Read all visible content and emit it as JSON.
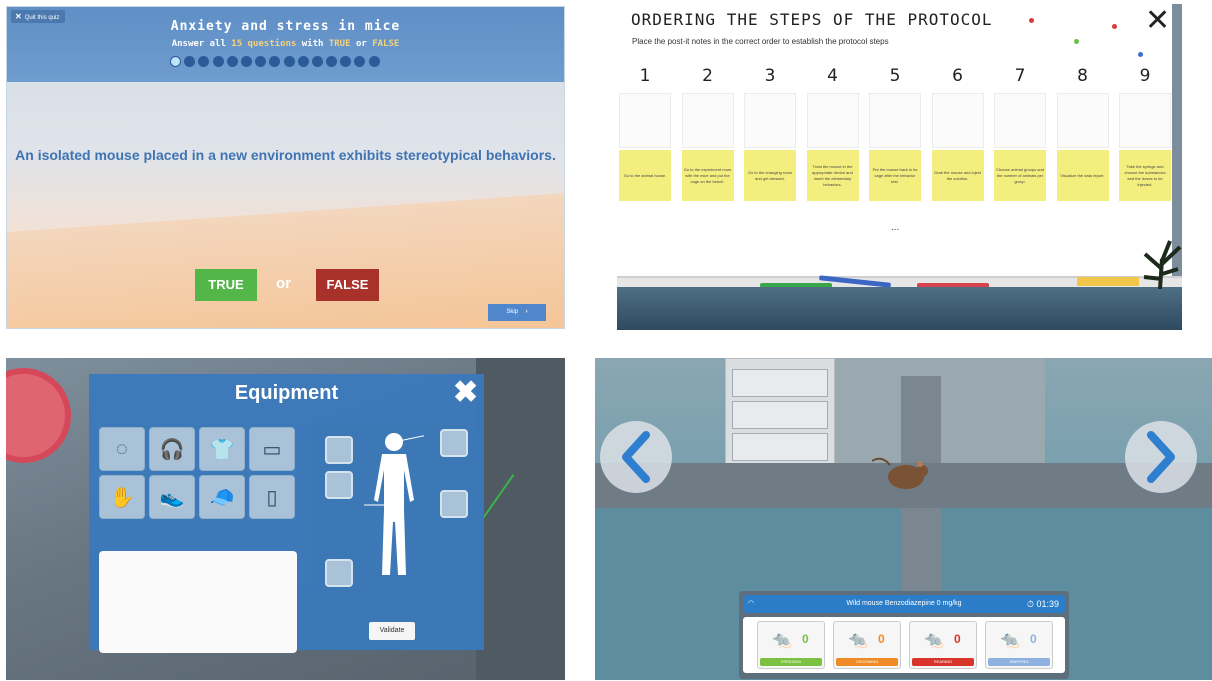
{
  "quiz": {
    "quit_label": "Quit this quiz",
    "title": "Anxiety and stress in mice",
    "subtitle_prefix": "Answer all ",
    "subtitle_count": "15 questions",
    "subtitle_mid": " with ",
    "subtitle_true": "TRUE",
    "subtitle_or": " or ",
    "subtitle_false": "FALSE",
    "question": "An isolated mouse placed in a new environment exhibits stereotypical behaviors.",
    "true_label": "TRUE",
    "or_label": "or",
    "false_label": "FALSE",
    "skip_label": "Skip",
    "total_questions": 15,
    "current_question": 1,
    "colors": {
      "header": "#6a98cd",
      "true": "#52b649",
      "false": "#a8322a",
      "accent": "#f6d17a"
    }
  },
  "protocol": {
    "title": "ORDERING THE STEPS OF THE PROTOCOL",
    "subtitle": "Place the post-it notes in the correct order to establish the protocol steps",
    "close_icon": "close-icon",
    "steps": [
      "1",
      "2",
      "3",
      "4",
      "5",
      "6",
      "7",
      "8",
      "9"
    ],
    "notes": [
      "Go to the animal house.",
      "Go to the experiment room with the mice and put the cage on the bench.",
      "Go to the changing room and get dressed.",
      "Treat the mouse in the appropriate device and insert the elementary behaviors.",
      "Put the mouse back in its cage after the behavior test.",
      "Grab the mouse and inject the solution.",
      "Choose animal groups and the number of animals per group.",
      "Visualize the data report.",
      "Take the syringe and choose the substances and the doses to be injected."
    ],
    "ellipsis": "...",
    "colors": {
      "note": "#f3ee7e"
    }
  },
  "equipment": {
    "title": "Equipment",
    "validate_label": "Validate",
    "items": [
      "hairnet-icon",
      "headphones-icon",
      "lab-coat-icon",
      "mask-icon",
      "gloves-icon",
      "shoe-covers-icon",
      "cap-icon",
      "phone-icon"
    ]
  },
  "maze": {
    "hud_title": "Wild mouse Benzodiazepine 0 mg/kg",
    "timer": "01:39",
    "behaviors": [
      {
        "label": "FREEZING",
        "value": "0",
        "color": "#7cc142"
      },
      {
        "label": "GROOMING",
        "value": "0",
        "color": "#f08a24"
      },
      {
        "label": "REARING",
        "value": "0",
        "color": "#d9342b"
      },
      {
        "label": "SNIFFING",
        "value": "0",
        "color": "#8fb1df"
      }
    ]
  }
}
